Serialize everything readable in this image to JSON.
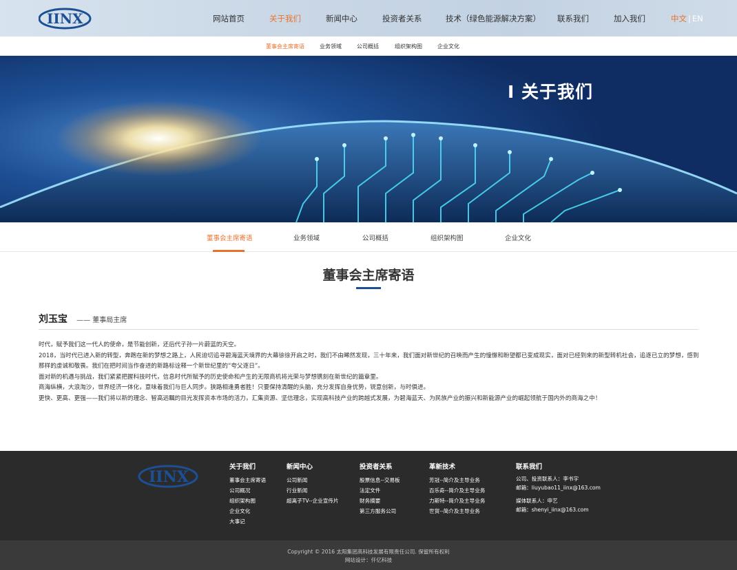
{
  "header": {
    "logo_text": "IINX",
    "nav": [
      {
        "label": "网站首页",
        "active": false
      },
      {
        "label": "关于我们",
        "active": true
      },
      {
        "label": "新闻中心",
        "active": false
      },
      {
        "label": "投资者关系",
        "active": false
      },
      {
        "label": "技术（绿色能源解决方案）",
        "active": false
      },
      {
        "label": "联系我们",
        "active": false
      },
      {
        "label": "加入我们",
        "active": false
      }
    ],
    "lang_cn": "中文",
    "lang_sep": "|",
    "lang_en": "EN"
  },
  "subnav": [
    "董事会主席寄语",
    "业务领域",
    "公司概括",
    "组织架构图",
    "企业文化"
  ],
  "banner": {
    "title": "I 关于我们"
  },
  "tabs": [
    "董事会主席寄语",
    "业务领域",
    "公司概括",
    "组织架构图",
    "企业文化"
  ],
  "content": {
    "title": "董事会主席寄语",
    "person_name": "刘玉宝",
    "person_role": "—— 董事局主席",
    "paragraphs": [
      "时代，赋予我们这一代人的使命，是节能创新，还后代子孙一片蔚蓝的天空。",
      "2018，当时代已进入新的转型，奔跑在新的梦想之路上，人民迫切追寻碧海蓝天境界的大幕徐徐开启之时，我们不由晞然发现，三十年来，我们面对新世纪的召唤而产生的憧憬和盼望都已变成现实，面对已经到来的新型转机社会，追逐已立的梦想，感到那样的虔诚和敬畏。我们在把时间当作奋进的新路标诠释一个新世纪里的“夸父逐日”。",
      "面对新的机遇与挑战，我们紧紧把握科技时代，信息时代所赋予的历史使命和产生的无限商机将光荣与梦想镌刻在新世纪的篇章里。",
      "商海纵横，大浪淘沙，世界经济一体化，意味着我们与巨人同步。狭路相逢勇者胜！只要保持清醒的头脑，充分发挥自身优势，锐意创新，与时俱进。",
      "更快、更高、更强——我们将以新的理念、智高远瞩的目光发挥资本市场的活力，汇集资源、坚信理念，实现高科技产业的跨越式发展，为碧海蓝天、为民族产业的振兴和新能源产业的崛起领航于国内外的商海之中！"
    ]
  },
  "footer": {
    "logo_text": "IINX",
    "columns": [
      {
        "title": "关于我们",
        "items": [
          "董事会主席寄语",
          "公司概况",
          "组织架构图",
          "企业文化",
          "大事记"
        ]
      },
      {
        "title": "新闻中心",
        "items": [
          "公司新闻",
          "行业新闻",
          "超离子TV--企业宣传片"
        ]
      },
      {
        "title": "投资者关系",
        "items": [
          "股票信息--交易板",
          "法定文件",
          "财务摘要",
          "第三方服务公司"
        ]
      },
      {
        "title": "革新技术",
        "items": [
          "芳冠--简介及主导业务",
          "百乐奇--简介及主导业务",
          "力斯特--简介及主导业务",
          "世贸--简介及主导业务"
        ]
      }
    ],
    "contact": {
      "title": "联系我们",
      "lines1": [
        "公司、投资联系人：李书宇",
        "邮箱：liuyubao11_iinx@163.com"
      ],
      "lines2": [
        "媒体联系人：申艺",
        "邮箱：shenyi_iinx@163.com"
      ]
    },
    "copyright": "Copyright © 2016 太阳集团高科技发展有限责任公司. 保留所有权利",
    "design": "网站设计：仟亿科技"
  },
  "colors": {
    "accent": "#e9722a",
    "brand": "#1d4f95",
    "footer_bg": "#2b2b2b"
  }
}
